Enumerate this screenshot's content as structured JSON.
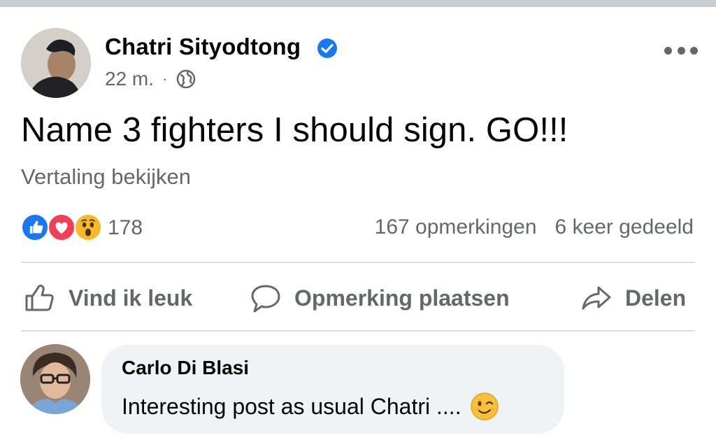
{
  "post": {
    "author": {
      "name": "Chatri Sityodtong",
      "verified": true
    },
    "time": "22 m.",
    "separator": "·",
    "audience_icon": "globe-icon",
    "text": "Name 3 fighters I should sign. GO!!!",
    "translate_link": "Vertaling bekijken"
  },
  "reactions": {
    "icons": [
      "like-reaction-icon",
      "love-reaction-icon",
      "wow-reaction-icon"
    ],
    "count": "178",
    "comments": "167 opmerkingen",
    "shares": "6 keer gedeeld"
  },
  "actions": {
    "like": "Vind ik leuk",
    "comment": "Opmerking plaatsen",
    "share": "Delen"
  },
  "comment": {
    "author": "Carlo Di Blasi",
    "text": "Interesting post as usual Chatri ....",
    "emoji": "winking-face-icon"
  },
  "colors": {
    "brand_blue": "#1877f2",
    "love_red": "#f33e58",
    "wow_yellow": "#f7b928",
    "secondary_text": "#65676b",
    "bubble_bg": "#f0f2f5"
  }
}
